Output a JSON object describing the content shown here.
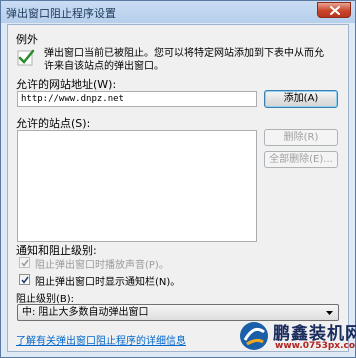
{
  "window": {
    "title": "弹出窗口阻止程序设置"
  },
  "exceptions": {
    "section_label": "例外",
    "info_text_line1": "弹出窗口当前已被阻止。您可以将特定网站添加到下表中从而允",
    "info_text_line2": "许来自该站点的弹出窗口。",
    "address_label": "允许的网站地址(W):",
    "address_value": "http://www.dnpz.net",
    "add_button": "添加(A)",
    "allowed_sites_label": "允许的站点(S):",
    "remove_button": "删除(R)",
    "remove_all_button": "全部删除(E)...",
    "allowed_sites": []
  },
  "notifications": {
    "section_label": "通知和阻止级别:",
    "play_sound_label": "阻止弹出窗口时播放声音(P)。",
    "play_sound_checked": true,
    "play_sound_enabled": false,
    "show_bar_label": "阻止弹出窗口时显示通知栏(N)。",
    "show_bar_checked": true,
    "blocking_level_label": "阻止级别(B):",
    "blocking_level_value": "中: 阻止大多数自动弹出窗口"
  },
  "footer": {
    "learn_more_link": "了解有关弹出窗口阻止程序的详细信息"
  },
  "watermark": {
    "brand": "鹏鑫装机网",
    "url": "www.0753px.com"
  },
  "icons": {
    "info_icon": "checkmark-shield-icon",
    "close_icon": "close-icon",
    "dropdown_icon": "chevron-down-icon"
  },
  "colors": {
    "titlebar": "#b6cfec",
    "close_button": "#c9452a",
    "link": "#0066cc",
    "watermark_brand": "#1a2c5e",
    "watermark_url": "#b22222"
  }
}
